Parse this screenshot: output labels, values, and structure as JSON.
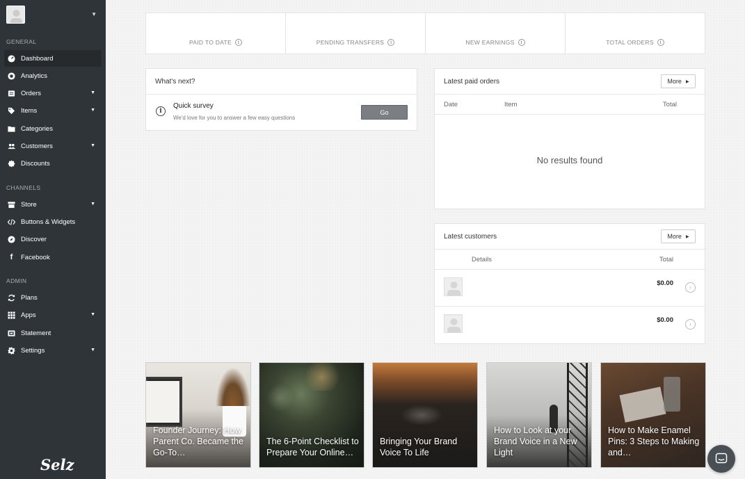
{
  "sidebar": {
    "sections": [
      {
        "label": "GENERAL"
      },
      {
        "label": "CHANNELS"
      },
      {
        "label": "ADMIN"
      }
    ],
    "items": [
      {
        "label": "Dashboard",
        "icon": "dashboard-icon",
        "active": true
      },
      {
        "label": "Analytics",
        "icon": "analytics-icon"
      },
      {
        "label": "Orders",
        "icon": "orders-icon",
        "dropdown": true
      },
      {
        "label": "Items",
        "icon": "tag-icon",
        "dropdown": true
      },
      {
        "label": "Categories",
        "icon": "folder-icon"
      },
      {
        "label": "Customers",
        "icon": "customers-icon",
        "dropdown": true
      },
      {
        "label": "Discounts",
        "icon": "discount-icon"
      },
      {
        "label": "Store",
        "icon": "store-icon",
        "dropdown": true
      },
      {
        "label": "Buttons & Widgets",
        "icon": "code-icon"
      },
      {
        "label": "Discover",
        "icon": "discover-icon"
      },
      {
        "label": "Facebook",
        "icon": "facebook-icon"
      },
      {
        "label": "Plans",
        "icon": "refresh-icon"
      },
      {
        "label": "Apps",
        "icon": "apps-grid-icon",
        "dropdown": true
      },
      {
        "label": "Statement",
        "icon": "statement-icon"
      },
      {
        "label": "Settings",
        "icon": "gear-icon",
        "dropdown": true
      }
    ],
    "logo": "Selz"
  },
  "stats": [
    {
      "label": "PAID TO DATE"
    },
    {
      "label": "PENDING TRANSFERS"
    },
    {
      "label": "NEW EARNINGS"
    },
    {
      "label": "TOTAL ORDERS"
    }
  ],
  "whats_next": {
    "title": "What's next?",
    "survey_title": "Quick survey",
    "survey_sub": "We'd love for you to answer a few easy questions",
    "go_label": "Go"
  },
  "latest_orders": {
    "title": "Latest paid orders",
    "more_label": "More",
    "columns": [
      "Date",
      "Item",
      "Total"
    ],
    "empty_text": "No results found"
  },
  "latest_customers": {
    "title": "Latest customers",
    "more_label": "More",
    "columns": [
      "Details",
      "Total"
    ],
    "rows": [
      {
        "total": "$0.00"
      },
      {
        "total": "$0.00"
      }
    ]
  },
  "articles": [
    {
      "title": "Founder Journey: How Parent Co. Became the Go-To…"
    },
    {
      "title": "The 6-Point Checklist to Prepare Your Online…"
    },
    {
      "title": "Bringing Your Brand Voice To Life"
    },
    {
      "title": "How to Look at your Brand Voice in a New Light"
    },
    {
      "title": "How to Make Enamel Pins: 3 Steps to Making and…"
    }
  ],
  "colors": {
    "sidebar_bg": "#2f3438",
    "active_item_bg": "#262a2d",
    "go_button": "#7b7f83"
  }
}
